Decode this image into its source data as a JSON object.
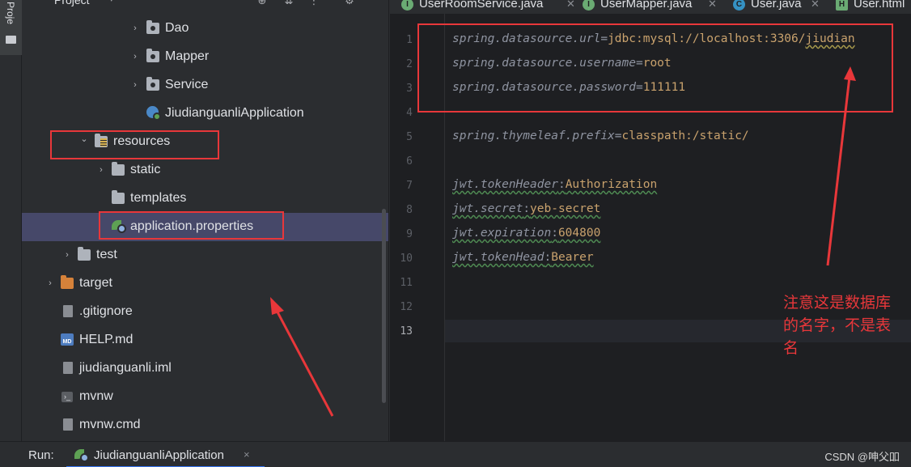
{
  "tool_stripe": {
    "label": "Proje"
  },
  "project_panel": {
    "title": "Project",
    "tree": [
      {
        "label": "Dao",
        "kind": "package",
        "expander": "›"
      },
      {
        "label": "Mapper",
        "kind": "package",
        "expander": "›"
      },
      {
        "label": "Service",
        "kind": "package",
        "expander": "›"
      },
      {
        "label": "JiudianguanliApplication",
        "kind": "spring-app"
      },
      {
        "label": "resources",
        "kind": "resources-folder",
        "expander": "⌄"
      },
      {
        "label": "static",
        "kind": "folder",
        "expander": "›"
      },
      {
        "label": "templates",
        "kind": "folder"
      },
      {
        "label": "application.properties",
        "kind": "properties-file"
      },
      {
        "label": "test",
        "kind": "folder",
        "expander": "›"
      },
      {
        "label": "target",
        "kind": "excluded-folder",
        "expander": "›"
      },
      {
        "label": ".gitignore",
        "kind": "file"
      },
      {
        "label": "HELP.md",
        "kind": "markdown"
      },
      {
        "label": "jiudianguanli.iml",
        "kind": "file"
      },
      {
        "label": "mvnw",
        "kind": "script"
      },
      {
        "label": "mvnw.cmd",
        "kind": "file"
      }
    ]
  },
  "editor": {
    "tabs": [
      {
        "label": "UserRoomService.java",
        "icon": "interface-icon",
        "icon_letter": "I",
        "icon_color": "#6aab73"
      },
      {
        "label": "UserMapper.java",
        "icon": "interface-icon",
        "icon_letter": "I",
        "icon_color": "#6aab73"
      },
      {
        "label": "User.java",
        "icon": "class-icon",
        "icon_letter": "C",
        "icon_color": "#3592c4"
      },
      {
        "label": "User.html",
        "icon": "html-icon",
        "icon_letter": "H",
        "icon_color": "#6aab73"
      }
    ],
    "line_numbers": [
      "1",
      "2",
      "3",
      "4",
      "5",
      "6",
      "7",
      "8",
      "9",
      "10",
      "11",
      "12",
      "13"
    ],
    "current_line": "13",
    "lines": {
      "l1_key": "spring.datasource.url",
      "l1_sep": "=",
      "l1_val_a": "jdbc:mysql://localhost:3306/",
      "l1_val_b": "jiudian",
      "l2_key": "spring.datasource.username",
      "l2_sep": "=",
      "l2_val": "root",
      "l3_key": "spring.datasource.password",
      "l3_sep": "=",
      "l3_val": "111111",
      "l5_key": "spring.thymeleaf.prefix",
      "l5_sep": "=",
      "l5_val": "classpath:/static/",
      "l7_key": "jwt.tokenHeader",
      "l7_sep": ":",
      "l7_val": "Authorization",
      "l8_key": "jwt.secret",
      "l8_sep": ":",
      "l8_val": "yeb-secret",
      "l9_key": "jwt.expiration",
      "l9_sep": ":",
      "l9_val": "604800",
      "l10_key": "jwt.tokenHead",
      "l10_sep": ":",
      "l10_val": "Bearer"
    }
  },
  "annotation": {
    "note_line1": "注意这是数据库",
    "note_line2": "的名字，不是表",
    "note_line3": "名",
    "color": "#e8373a"
  },
  "run_bar": {
    "label": "Run:",
    "tab_label": "JiudianguanliApplication",
    "close": "×",
    "watermark": "CSDN @呻父吅"
  }
}
